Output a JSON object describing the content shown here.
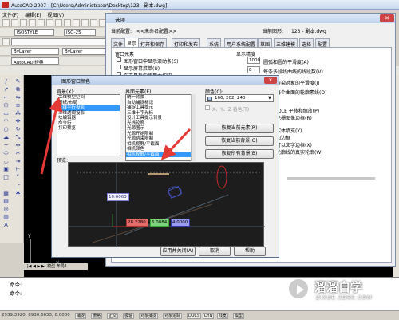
{
  "app": {
    "title": "AutoCAD 2007 - [C:\\Users\\Administrator\\Desktop\\123 - 副本.dwg]",
    "menu": [
      "文件(F)",
      "编辑(E)",
      "视图(V)"
    ],
    "style_combo": "ISOSTYLE",
    "dim_combo": "ISO-25",
    "layer_combo": "ByLayer",
    "workspace_combo": "AutoCAD 经典"
  },
  "options_dialog": {
    "title": "选项",
    "current_profile_label": "当前配置:",
    "current_profile_value": "<<未命名配置>>",
    "current_drawing_label": "当前图形:",
    "current_drawing_value": "123 - 副本.dwg",
    "tabs": [
      "文件",
      "显示",
      "打开和保存",
      "打印和发布",
      "系统",
      "用户系统配置",
      "草图",
      "三维建模",
      "选择",
      "配置"
    ],
    "active_tab": "显示",
    "window_elements_label": "窗口元素",
    "window_items": [
      "图形窗口中显示滚动条(S)",
      "显示屏幕菜单(U)",
      "在工具栏中使用大按钮"
    ],
    "display_precision_label": "显示精度",
    "precision_items": [
      {
        "value": "1000",
        "label": "圆弧和圆的平滑度(A)"
      },
      {
        "value": "8",
        "label": "每条多段线曲线的线段数(V)"
      },
      {
        "value": "",
        "label": "渲染对象的平滑度(J)"
      },
      {
        "value": "",
        "label": "每个曲面的轮廓素线(O)"
      }
    ],
    "right_fragments": [
      "/OLE 平移和缩放(P)",
      "光栅图像边框(R)",
      "实体填充(Y)",
      "和边框",
      "可以文字边框(X)",
      "轮廓线的真实轮廓(W)"
    ]
  },
  "color_dialog": {
    "title": "图形窗口颜色",
    "context_label": "背景(X):",
    "contexts": [
      "二维模型空间",
      "图纸/布局",
      "三维平行投影",
      "三维透视投影",
      "块编辑器",
      "命令行",
      "打印预览"
    ],
    "selected_context": 2,
    "element_label": "界面元素(E):",
    "elements": [
      "统一背景",
      "自动捕捉标记",
      "捕捉工具提示",
      "三维十字光标",
      "设计工具提示背景",
      "光线轮廓",
      "光源图示",
      "光源开始限制",
      "光源结束限制",
      "相机视野/平截面",
      "相机颜色",
      "相机视野/平截面"
    ],
    "selected_element": 11,
    "color_label": "颜色(C):",
    "color_value": "166, 202, 240",
    "tint_label": "X、Y、Z 着色(T)",
    "buttons": {
      "restore_element": "恢复当前元素(R)",
      "restore_context": "恢复当前背景(O)",
      "restore_all": "恢复所有背景(B)",
      "apply_close": "应用并关闭(A)",
      "cancel": "取消",
      "help": "帮助"
    },
    "preview_label": "预览:",
    "preview_values": [
      "10.6063",
      "28.2280",
      "6.0884",
      "4.0000"
    ],
    "colors": {
      "selection": "#3399ff",
      "swatch": "#a6caf0"
    }
  },
  "command": {
    "lines": [
      "命令:",
      "命令:"
    ]
  },
  "status": {
    "coords": "2939.3920, 8930.6653, 0.0000",
    "buttons": [
      "捕捉",
      "栅格",
      "正交",
      "极轴",
      "对象捕捉",
      "对象追踪",
      "DUCS",
      "DYN",
      "线宽",
      "模型"
    ]
  },
  "watermark": {
    "title": "溜溜自学",
    "url": "ZIXUE.3D66.COM"
  }
}
